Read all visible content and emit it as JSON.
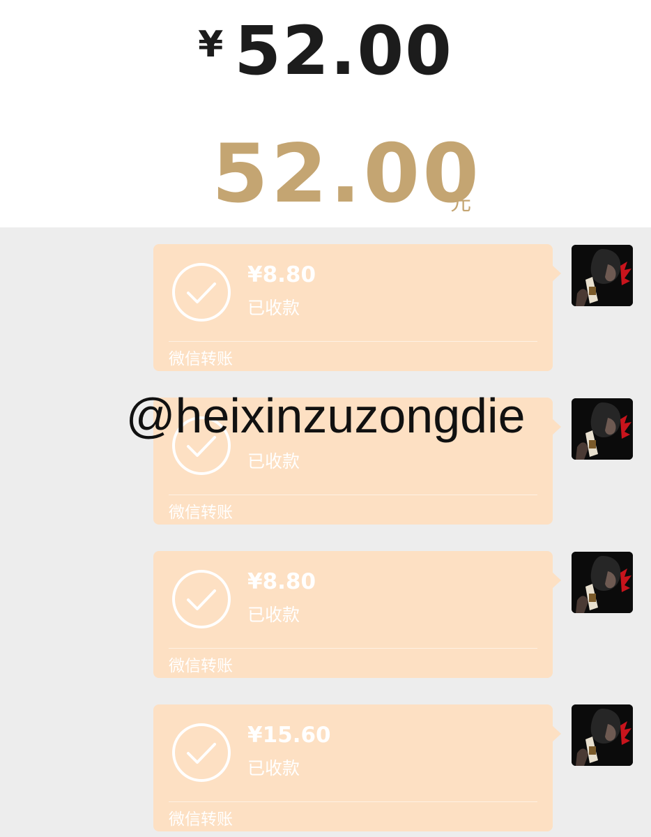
{
  "header": {
    "currency_symbol": "¥",
    "amount": "52.00",
    "total_amount": "52.00",
    "total_unit": "元"
  },
  "transfers": [
    {
      "amount": "¥8.80",
      "status": "已收款",
      "source": "微信转账"
    },
    {
      "amount": "",
      "status": "已收款",
      "source": "微信转账"
    },
    {
      "amount": "¥8.80",
      "status": "已收款",
      "source": "微信转账"
    },
    {
      "amount": "¥15.60",
      "status": "已收款",
      "source": "微信转账"
    }
  ],
  "watermark": "@heixinzuzongdie",
  "colors": {
    "gold": "#c4a572",
    "card": "#fde0c3",
    "background": "#ededed"
  },
  "icons": {
    "received": "check-circle-icon"
  }
}
